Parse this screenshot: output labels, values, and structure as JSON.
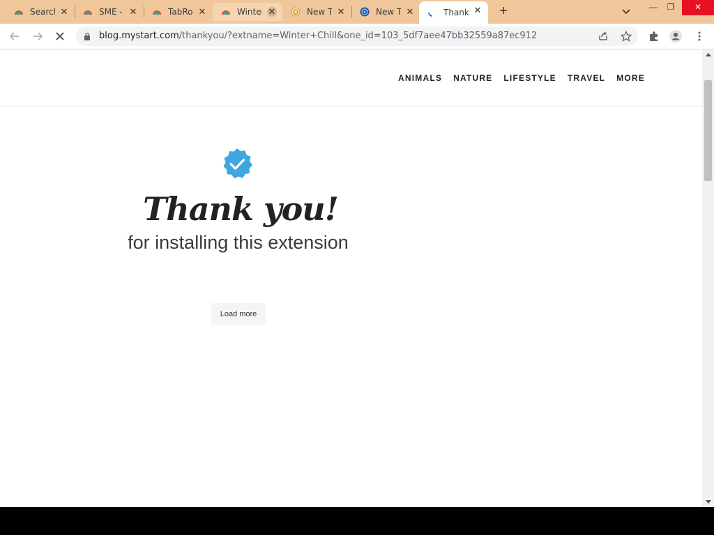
{
  "browser": {
    "tabs": [
      {
        "title": "Search",
        "icon": "rainbow-logo-icon",
        "state": "normal"
      },
      {
        "title": "SME -",
        "icon": "rainbow-logo-icon",
        "state": "normal"
      },
      {
        "title": "TabRo",
        "icon": "rainbow-logo-icon",
        "state": "normal"
      },
      {
        "title": "Winter",
        "icon": "rainbow-logo-icon",
        "state": "hover"
      },
      {
        "title": "New T",
        "icon": "extension-orange-icon",
        "state": "normal"
      },
      {
        "title": "New T",
        "icon": "globe-blue-icon",
        "state": "normal"
      },
      {
        "title": "Thank",
        "icon": "loading-spinner-icon",
        "state": "active"
      }
    ],
    "url_domain": "blog.mystart.com",
    "url_path": "/thankyou/?extname=Winter+Chill&one_id=103_5df7aee47bb32559a87ec912"
  },
  "site": {
    "nav": [
      "ANIMALS",
      "NATURE",
      "LIFESTYLE",
      "TRAVEL",
      "MORE"
    ]
  },
  "main": {
    "heading": "Thank you!",
    "subheading": "for installing this extension",
    "load_more_label": "Load more"
  },
  "colors": {
    "tabstrip": "#f0c79b",
    "badge": "#3ea7e0",
    "window_close": "#e81123"
  }
}
